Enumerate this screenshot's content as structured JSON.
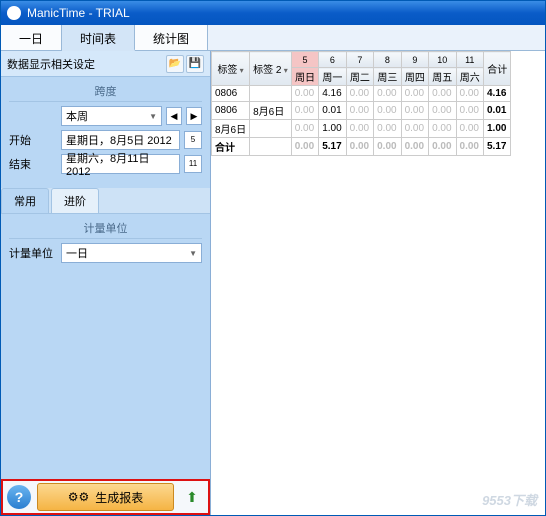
{
  "titlebar": {
    "title": "ManicTime - TRIAL"
  },
  "tabs": {
    "day": "一日",
    "timesheet": "时间表",
    "stats": "统计图"
  },
  "settings": {
    "header": "数据显示相关设定",
    "span_title": "跨度",
    "period": "本周",
    "start_label": "开始",
    "start_value": "星期日，8月5日 2012",
    "start_day": "5",
    "end_label": "结束",
    "end_value": "星期六，8月11日 2012",
    "end_day": "11"
  },
  "subtabs": {
    "common": "常用",
    "advanced": "进阶"
  },
  "unit": {
    "section": "计量单位",
    "label": "计量单位",
    "value": "一日"
  },
  "buttons": {
    "generate": "生成报表"
  },
  "grid": {
    "col_tag1": "标签",
    "col_tag2": "标签 2",
    "days": [
      {
        "n": "5",
        "d": "周日"
      },
      {
        "n": "6",
        "d": "周一"
      },
      {
        "n": "7",
        "d": "周二"
      },
      {
        "n": "8",
        "d": "周三"
      },
      {
        "n": "9",
        "d": "周四"
      },
      {
        "n": "10",
        "d": "周五"
      },
      {
        "n": "11",
        "d": "周六"
      }
    ],
    "col_total": "合计",
    "rows": [
      {
        "tag1": "0806",
        "tag2": "",
        "vals": [
          "0.00",
          "4.16",
          "0.00",
          "0.00",
          "0.00",
          "0.00",
          "0.00"
        ],
        "total": "4.16"
      },
      {
        "tag1": "0806",
        "tag2": "8月6日",
        "vals": [
          "0.00",
          "0.01",
          "0.00",
          "0.00",
          "0.00",
          "0.00",
          "0.00"
        ],
        "total": "0.01"
      },
      {
        "tag1": "8月6日",
        "tag2": "",
        "vals": [
          "0.00",
          "1.00",
          "0.00",
          "0.00",
          "0.00",
          "0.00",
          "0.00"
        ],
        "total": "1.00"
      }
    ],
    "total_label": "合计",
    "total_vals": [
      "0.00",
      "5.17",
      "0.00",
      "0.00",
      "0.00",
      "0.00",
      "0.00"
    ],
    "total_sum": "5.17"
  },
  "watermark": "9553下载"
}
